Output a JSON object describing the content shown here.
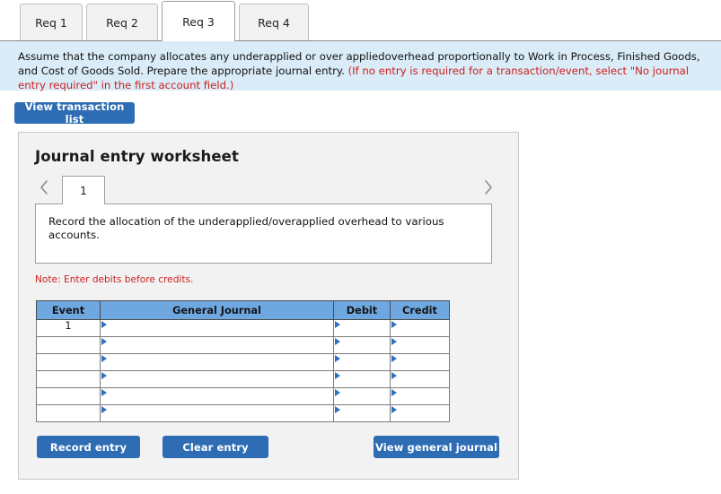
{
  "tabs": [
    {
      "label": "Req 1",
      "active": false
    },
    {
      "label": "Req 2",
      "active": false
    },
    {
      "label": "Req 3",
      "active": true
    },
    {
      "label": "Req 4",
      "active": false
    }
  ],
  "instruction": {
    "text_plain": "Assume that the company allocates any underapplied or over appliedoverhead proportionally to Work in Process, Finished Goods, and Cost of Goods Sold. Prepare the appropriate journal entry. ",
    "text_red": "(If no entry is required for a transaction/event, select \"No journal entry required\" in the first account field.)",
    "background_color": "#d9ecf7",
    "red_color": "#cc1f1f"
  },
  "toolbar": {
    "view_transaction_list_label": "View transaction list"
  },
  "worksheet": {
    "title": "Journal entry worksheet",
    "pager": {
      "prev_icon": "chevron-left-icon",
      "next_icon": "chevron-right-icon",
      "current_page": "1"
    },
    "description": "Record the allocation of the underapplied/overapplied overhead to various accounts.",
    "note": "Note: Enter debits before credits.",
    "table": {
      "headers": [
        "Event",
        "General Journal",
        "Debit",
        "Credit"
      ],
      "header_color": "#6fa7e0",
      "rows": [
        {
          "event": "1",
          "general_journal": "",
          "debit": "",
          "credit": ""
        },
        {
          "event": "",
          "general_journal": "",
          "debit": "",
          "credit": ""
        },
        {
          "event": "",
          "general_journal": "",
          "debit": "",
          "credit": ""
        },
        {
          "event": "",
          "general_journal": "",
          "debit": "",
          "credit": ""
        },
        {
          "event": "",
          "general_journal": "",
          "debit": "",
          "credit": ""
        },
        {
          "event": "",
          "general_journal": "",
          "debit": "",
          "credit": ""
        }
      ]
    },
    "buttons": {
      "record_entry": "Record entry",
      "clear_entry": "Clear entry",
      "view_general_journal": "View general journal"
    },
    "accent_color": "#2e6db4"
  }
}
